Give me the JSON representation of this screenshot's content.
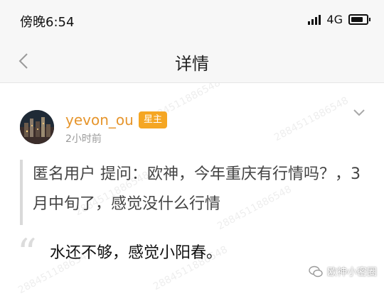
{
  "status_bar": {
    "time": "傍晚6:54",
    "network": "4G",
    "icons": [
      "signal-icon",
      "battery-icon"
    ]
  },
  "nav": {
    "title": "详情",
    "back_icon": "chevron-left-icon"
  },
  "post": {
    "author": "yevon_ou",
    "badge": "星主",
    "time": "2小时前",
    "author_color": "#e6952c",
    "badge_color": "#f5a623",
    "question": "匿名用户 提问：欧神，今年重庆有行情吗？，3月中旬了，感觉没什么行情",
    "answer": "水还不够，感觉小阳春。"
  },
  "watermark_text": "2884511886548",
  "wechat": {
    "label": "欧神小密圈",
    "icon": "wechat-icon"
  }
}
